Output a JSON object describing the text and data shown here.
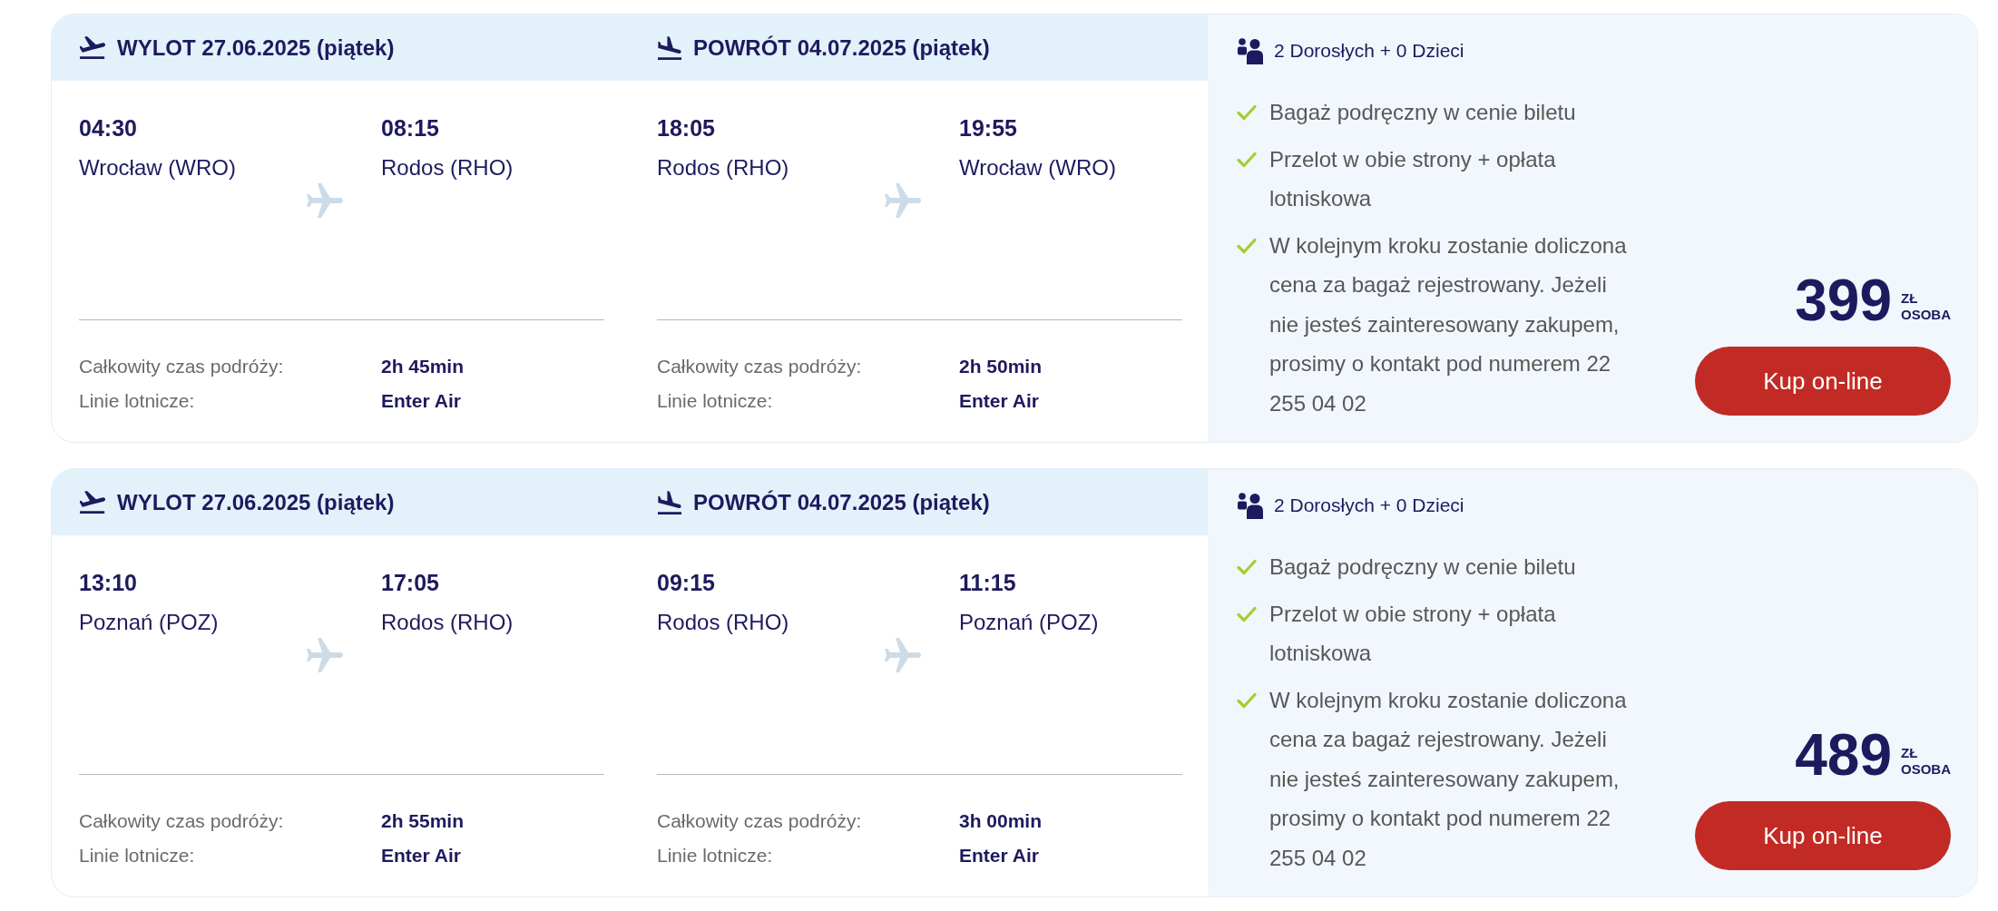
{
  "offers": [
    {
      "legs": [
        {
          "kind": "departure",
          "heading": "WYLOT 27.06.2025 (piątek)",
          "from": {
            "time": "04:30",
            "place": "Wrocław (WRO)"
          },
          "to": {
            "time": "08:15",
            "place": "Rodos (RHO)"
          },
          "details": [
            {
              "label": "Całkowity czas podróży:",
              "value": "2h 45min"
            },
            {
              "label": "Linie lotnicze:",
              "value": "Enter Air"
            }
          ]
        },
        {
          "kind": "return",
          "heading": "POWRÓT 04.07.2025 (piątek)",
          "from": {
            "time": "18:05",
            "place": "Rodos (RHO)"
          },
          "to": {
            "time": "19:55",
            "place": "Wrocław (WRO)"
          },
          "details": [
            {
              "label": "Całkowity czas podróży:",
              "value": "2h 50min"
            },
            {
              "label": "Linie lotnicze:",
              "value": "Enter Air"
            }
          ]
        }
      ],
      "summary": {
        "passengers": "2 Dorosłych + 0 Dzieci",
        "features": [
          "Bagaż podręczny w cenie biletu",
          "Przelot w obie strony + opłata lotniskowa",
          "W kolejnym kroku zostanie doliczona cena za bagaż rejestrowany. Jeżeli nie jesteś zainteresowany zakupem, prosimy o kontakt pod numerem 22 255 04 02"
        ],
        "price": "399",
        "currency": "ZŁ",
        "per": "OSOBA",
        "button": "Kup on-line"
      }
    },
    {
      "legs": [
        {
          "kind": "departure",
          "heading": "WYLOT 27.06.2025 (piątek)",
          "from": {
            "time": "13:10",
            "place": "Poznań (POZ)"
          },
          "to": {
            "time": "17:05",
            "place": "Rodos (RHO)"
          },
          "details": [
            {
              "label": "Całkowity czas podróży:",
              "value": "2h 55min"
            },
            {
              "label": "Linie lotnicze:",
              "value": "Enter Air"
            }
          ]
        },
        {
          "kind": "return",
          "heading": "POWRÓT 04.07.2025 (piątek)",
          "from": {
            "time": "09:15",
            "place": "Rodos (RHO)"
          },
          "to": {
            "time": "11:15",
            "place": "Poznań (POZ)"
          },
          "details": [
            {
              "label": "Całkowity czas podróży:",
              "value": "3h 00min"
            },
            {
              "label": "Linie lotnicze:",
              "value": "Enter Air"
            }
          ]
        }
      ],
      "summary": {
        "passengers": "2 Dorosłych + 0 Dzieci",
        "features": [
          "Bagaż podręczny w cenie biletu",
          "Przelot w obie strony + opłata lotniskowa",
          "W kolejnym kroku zostanie doliczona cena za bagaż rejestrowany. Jeżeli nie jesteś zainteresowany zakupem, prosimy o kontakt pod numerem 22 255 04 02"
        ],
        "price": "489",
        "currency": "ZŁ",
        "per": "OSOBA",
        "button": "Kup on-line"
      }
    }
  ]
}
